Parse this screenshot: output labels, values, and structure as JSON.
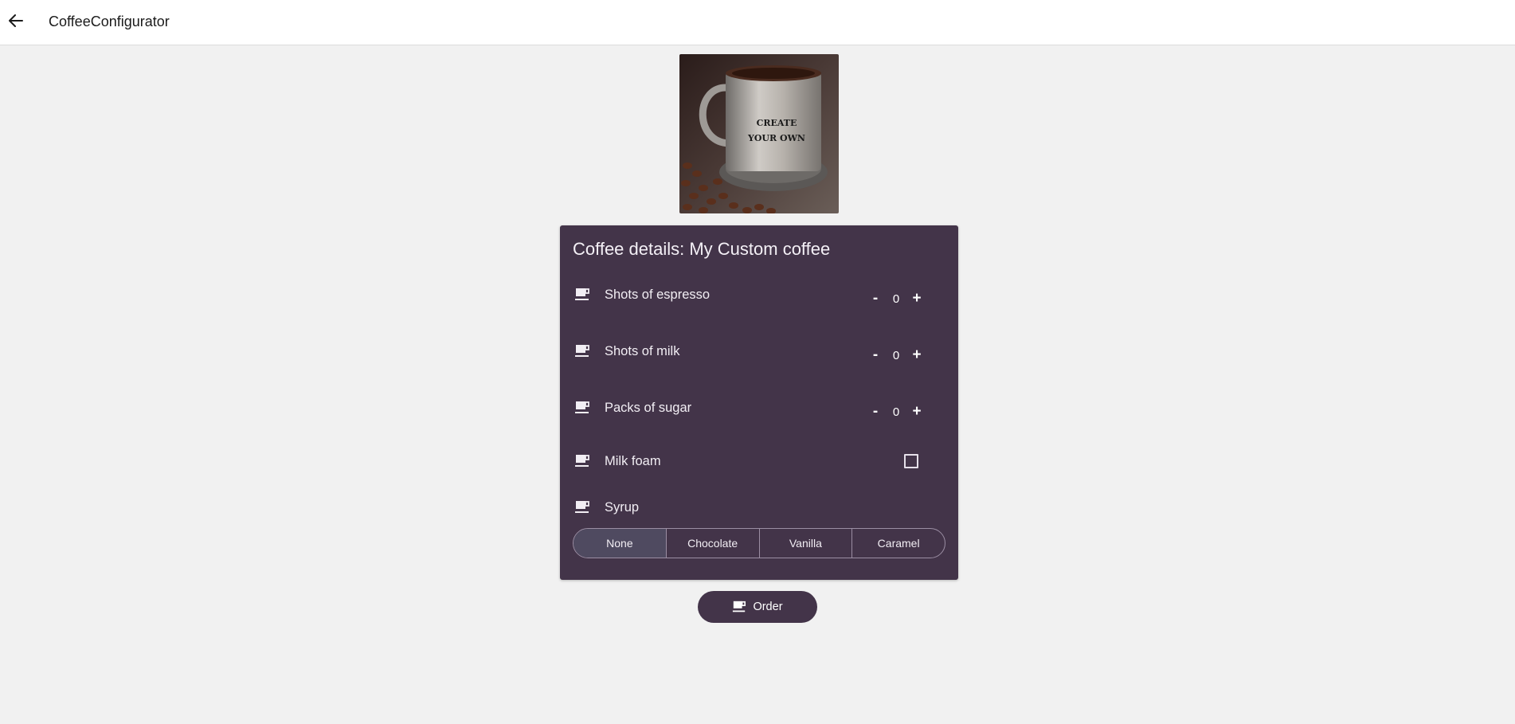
{
  "app": {
    "title": "CoffeeConfigurator"
  },
  "hero": {
    "text_line1": "CREATE",
    "text_line2": "YOUR OWN"
  },
  "card": {
    "title": "Coffee details: My Custom coffee",
    "rows": [
      {
        "label": "Shots of espresso",
        "value": "0",
        "dec": "-",
        "inc": "+"
      },
      {
        "label": "Shots of milk",
        "value": "0",
        "dec": "-",
        "inc": "+"
      },
      {
        "label": "Packs of sugar",
        "value": "0",
        "dec": "-",
        "inc": "+"
      }
    ],
    "milk_foam": {
      "label": "Milk foam",
      "checked": false
    },
    "syrup": {
      "label": "Syrup",
      "options": [
        "None",
        "Chocolate",
        "Vanilla",
        "Caramel"
      ],
      "selected": "None"
    }
  },
  "order": {
    "label": "Order"
  },
  "colors": {
    "accent": "#433449",
    "background": "#f1f1f1",
    "selected_segment": "#4f4a60"
  }
}
